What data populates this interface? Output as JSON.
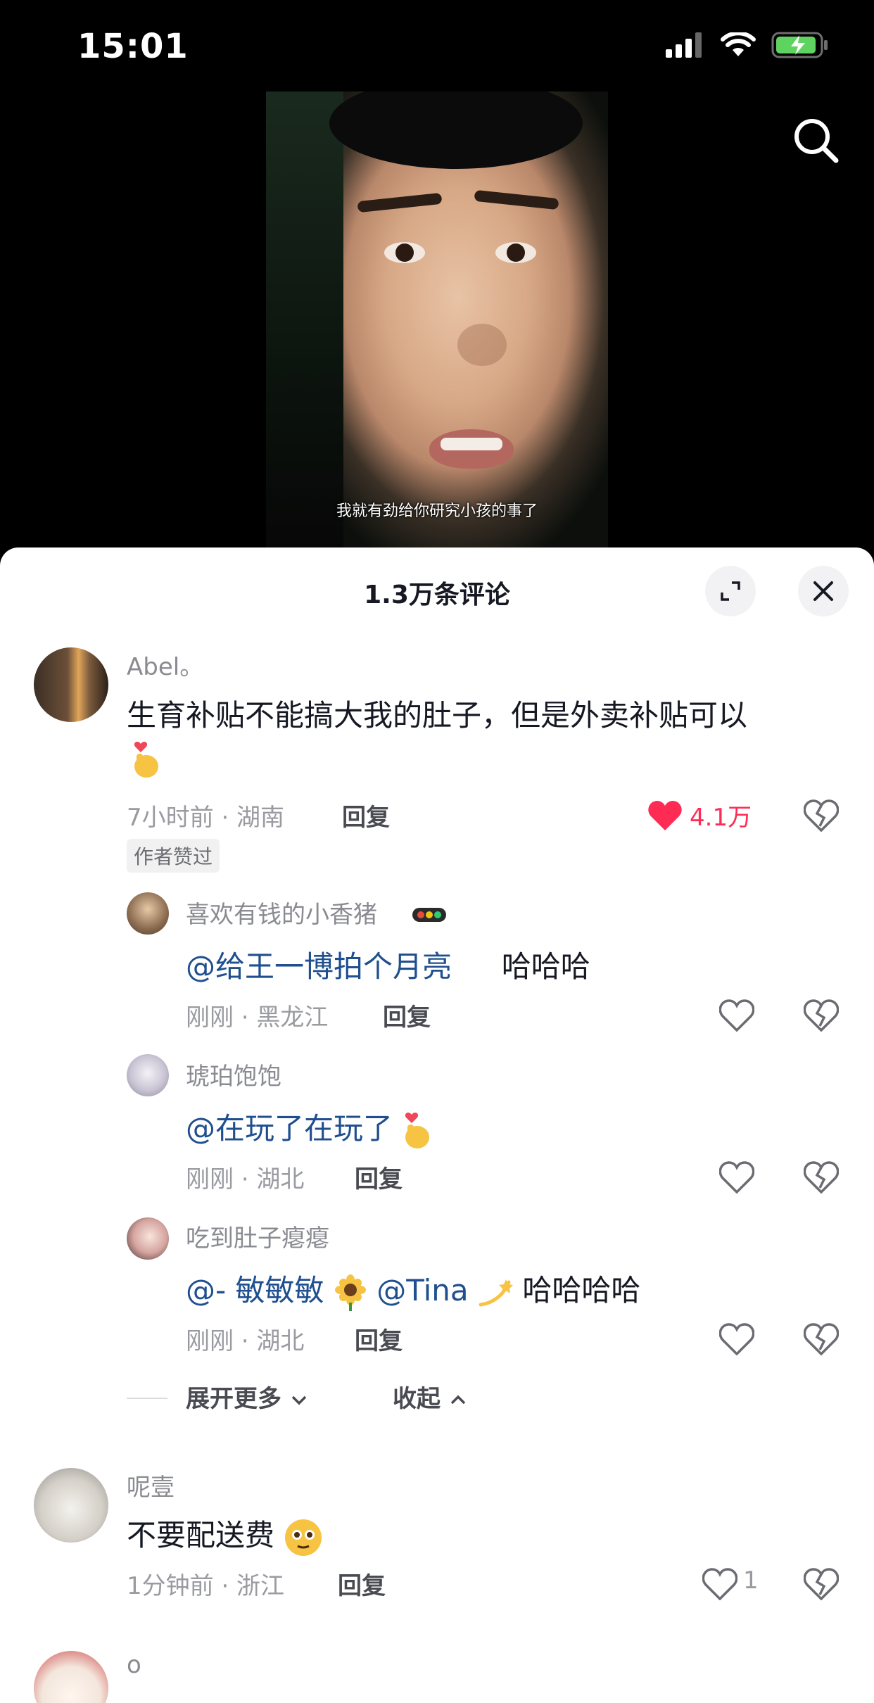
{
  "status_bar": {
    "time": "15:01"
  },
  "video": {
    "subtitle": "我就有劲给你研究小孩的事了"
  },
  "comments_panel": {
    "title": "1.3万条评论"
  },
  "comments": [
    {
      "user": "Abel。",
      "text": "生育补贴不能搞大我的肚子，但是外卖补贴可以",
      "meta": "7小时前 · 湖南",
      "reply_label": "回复",
      "likes": "4.1万",
      "badge": "作者赞过",
      "replies": [
        {
          "user": "喜欢有钱的小香猪",
          "mention": "@给王一博拍个月亮",
          "text": "哈哈哈",
          "meta": "刚刚 · 黑龙江",
          "reply_label": "回复"
        },
        {
          "user": "琥珀饱饱",
          "mention": "@在玩了在玩了",
          "text": "",
          "meta": "刚刚 · 湖北",
          "reply_label": "回复"
        },
        {
          "user": "吃到肚子瘪瘪",
          "mention": "@- 敏敏敏",
          "mention2": "@Tina",
          "text": "哈哈哈哈",
          "meta": "刚刚 · 湖北",
          "reply_label": "回复"
        }
      ],
      "expand_label": "展开更多",
      "collapse_label": "收起"
    },
    {
      "user": "呢壹",
      "text": "不要配送费",
      "meta": "1分钟前 · 浙江",
      "reply_label": "回复",
      "likes": "1"
    },
    {
      "user": "o"
    }
  ],
  "colors": {
    "accent_red": "#fe2c55",
    "mention_blue": "#1f4f8f"
  }
}
